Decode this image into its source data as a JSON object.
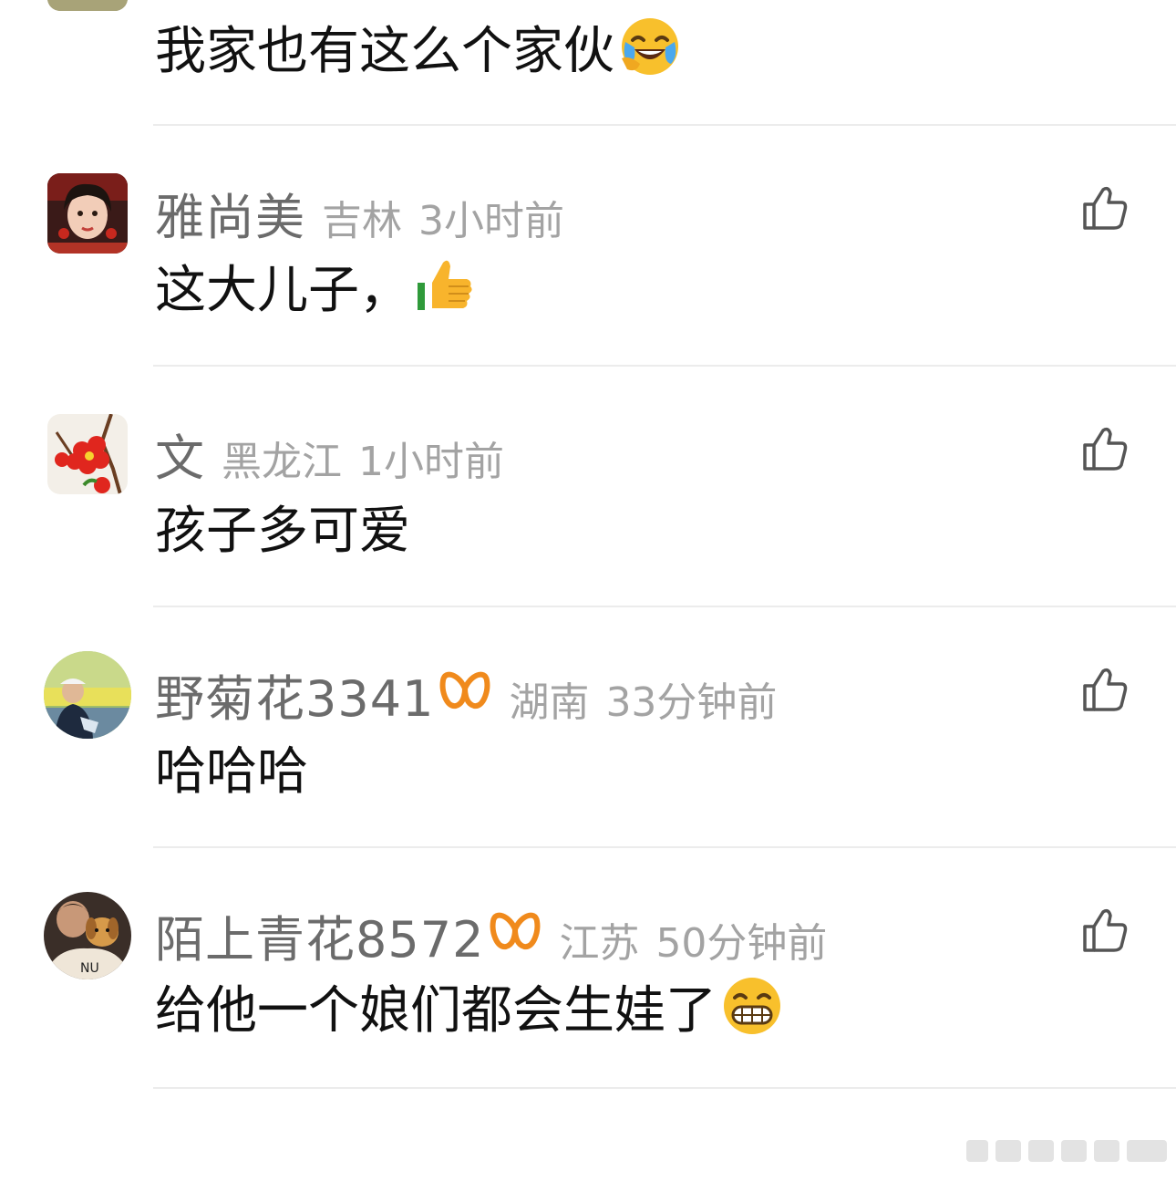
{
  "comments": [
    {
      "text": "我家也有这么个家伙",
      "emoji": "laughing-crying-emoji"
    },
    {
      "username": "雅尚美",
      "location": "吉林",
      "time": "3小时前",
      "text": "这大儿子，",
      "emoji": "thumbs-up-emoji",
      "avatar": "woman-portrait-avatar"
    },
    {
      "username": "文",
      "location": "黑龙江",
      "time": "1小时前",
      "text": "孩子多可爱",
      "avatar": "red-flower-avatar"
    },
    {
      "username": "野菊花3341",
      "vip_badge": "vip-badge-icon",
      "location": "湖南",
      "time": "33分钟前",
      "text": "哈哈哈",
      "avatar": "man-outdoors-avatar"
    },
    {
      "username": "陌上青花8572",
      "vip_badge": "vip-badge-icon",
      "location": "江苏",
      "time": "50分钟前",
      "text": "给他一个娘们都会生娃了",
      "emoji": "grinning-emoji",
      "avatar": "person-with-dog-avatar"
    }
  ],
  "icons": {
    "like": "thumbs-up-outline-icon"
  },
  "colors": {
    "username": "#6b6b6b",
    "meta": "#a3a3a3",
    "text": "#111111",
    "divider": "#ececec",
    "vip_badge": "#f08a1c"
  }
}
